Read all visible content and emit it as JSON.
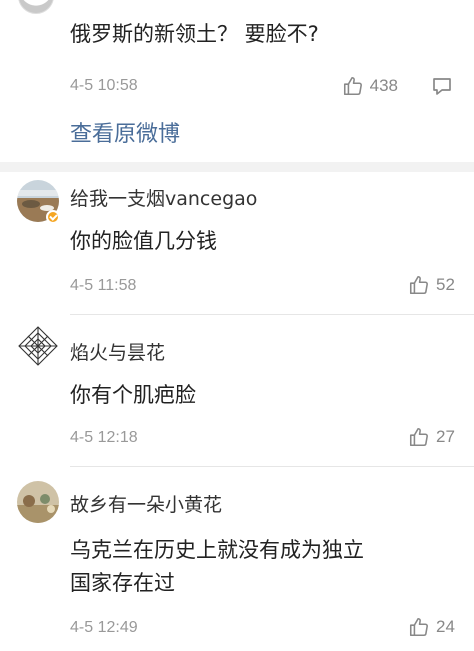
{
  "top_post": {
    "comment_text": "俄罗斯的新领土？ 要脸不?",
    "timestamp": "4-5 10:58",
    "like_count": "438",
    "like_icon": "thumbs-up-icon",
    "reply_icon": "comment-bubble-icon",
    "view_original_label": "查看原微博"
  },
  "comments": [
    {
      "username": "给我一支烟vancegao",
      "text_lines": [
        "你的脸值几分钱"
      ],
      "timestamp": "4-5 11:58",
      "like_count": "52",
      "verified": true
    },
    {
      "username": "焰火与昙花",
      "text_lines": [
        "你有个肌疤脸"
      ],
      "timestamp": "4-5 12:18",
      "like_count": "27",
      "verified": false
    },
    {
      "username": "故乡有一朵小黄花",
      "text_lines": [
        "乌克兰在历史上就没有成为独立",
        "国家存在过"
      ],
      "timestamp": "4-5 12:49",
      "like_count": "24",
      "verified": false
    }
  ],
  "colors": {
    "link": "#4a6d99",
    "meta": "#999999",
    "divider": "#f2f2f2",
    "badge": "#f5a623"
  }
}
